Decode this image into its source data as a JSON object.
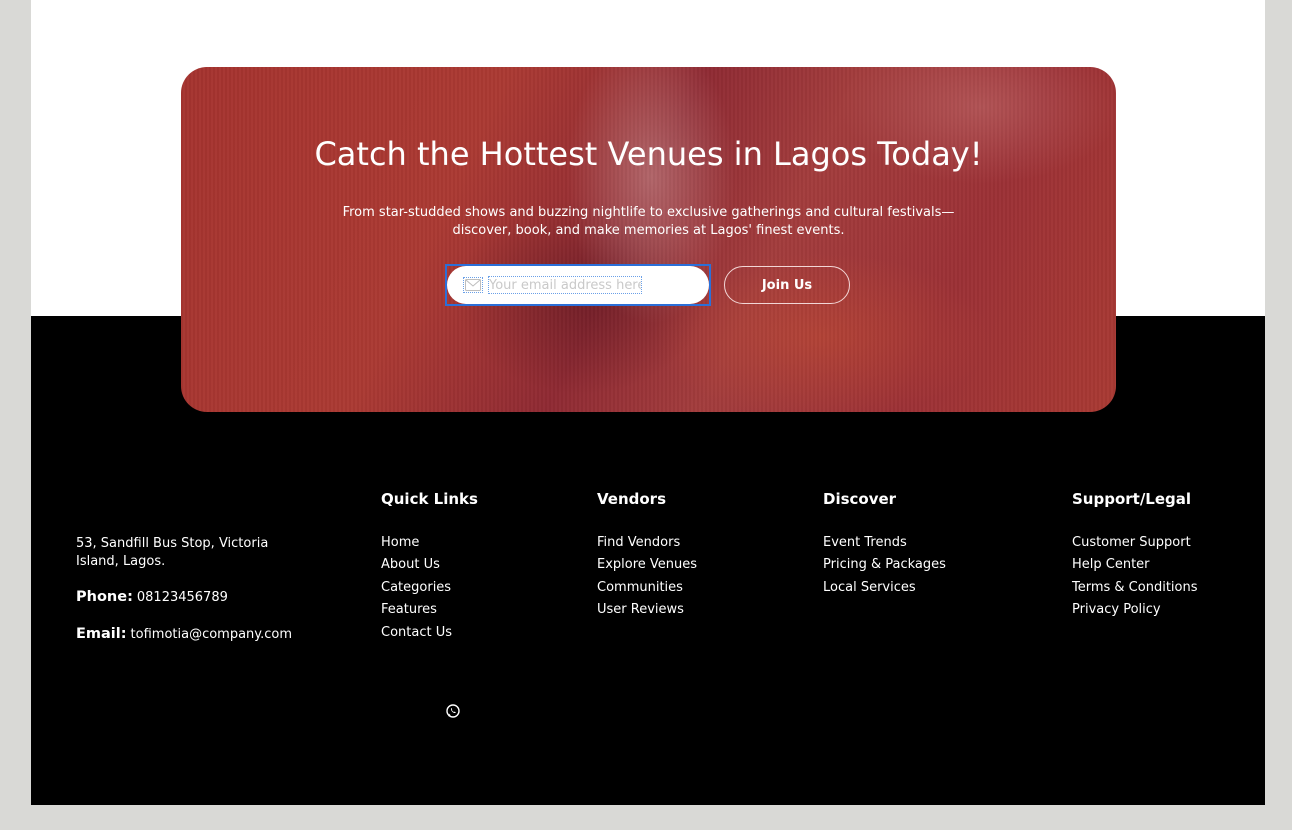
{
  "banner": {
    "title": "Catch the Hottest Venues in Lagos Today!",
    "subtitle": "From star-studded shows and buzzing nightlife to exclusive gatherings and cultural festivals—discover, book, and make memories at Lagos' finest events.",
    "email_placeholder": "Your email address here",
    "email_value": "",
    "join_label": "Join Us"
  },
  "footer": {
    "address": "53, Sandfill Bus Stop, Victoria Island, Lagos.",
    "phone_label": "Phone:",
    "phone": "08123456789",
    "email_label": "Email:",
    "email": "tofimotia@company.com",
    "columns": [
      {
        "title": "Quick Links",
        "items": [
          "Home",
          "About Us",
          "Categories",
          "Features",
          "Contact Us"
        ]
      },
      {
        "title": "Vendors",
        "items": [
          "Find Vendors",
          "Explore Venues",
          "Communities",
          "User Reviews"
        ]
      },
      {
        "title": "Discover",
        "items": [
          "Event Trends",
          "Pricing & Packages",
          "Local Services"
        ]
      },
      {
        "title": "Support/Legal",
        "items": [
          "Customer Support",
          "Help Center",
          "Terms & Conditions",
          "Privacy Policy"
        ]
      }
    ],
    "social_icons": [
      "whatsapp-icon"
    ]
  },
  "colors": {
    "banner": "#a5332f",
    "footer_bg": "#000000",
    "focus_outline": "#2b6fd8",
    "outer_bg": "#d9d9d6"
  }
}
